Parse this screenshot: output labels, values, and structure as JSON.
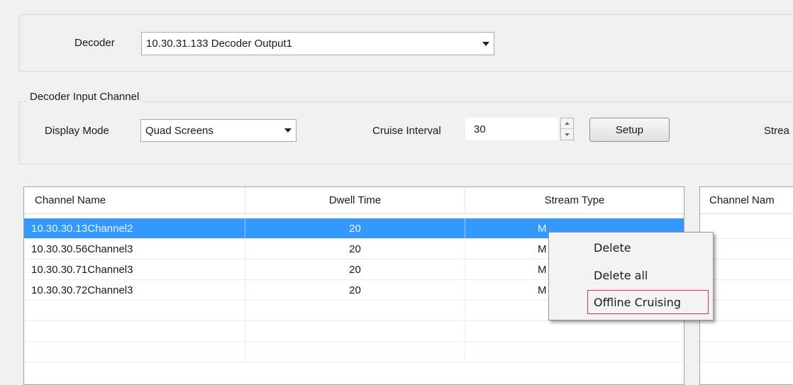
{
  "decoder": {
    "label": "Decoder",
    "value": "10.30.31.133 Decoder Output1"
  },
  "input_channel": {
    "title": "Decoder Input Channel",
    "display_mode_label": "Display Mode",
    "display_mode_value": "Quad Screens",
    "cruise_interval_label": "Cruise Interval",
    "cruise_interval_value": "30",
    "setup_label": "Setup",
    "stream_label_partial": "Strea"
  },
  "channel_table": {
    "columns": [
      "Channel Name",
      "Dwell Time",
      "Stream Type"
    ],
    "rows": [
      {
        "name": "10.30.30.13Channel2",
        "dwell": "20",
        "stream": "M",
        "selected": true
      },
      {
        "name": "10.30.30.56Channel3",
        "dwell": "20",
        "stream": "M",
        "selected": false
      },
      {
        "name": "10.30.30.71Channel3",
        "dwell": "20",
        "stream": "M",
        "selected": false
      },
      {
        "name": "10.30.30.72Channel3",
        "dwell": "20",
        "stream": "M",
        "selected": false
      }
    ]
  },
  "right_table": {
    "column_partial": "Channel Nam"
  },
  "context_menu": {
    "items": [
      "Delete",
      "Delete all",
      "Offline Cruising"
    ],
    "highlight_color": "#e03a3a"
  }
}
